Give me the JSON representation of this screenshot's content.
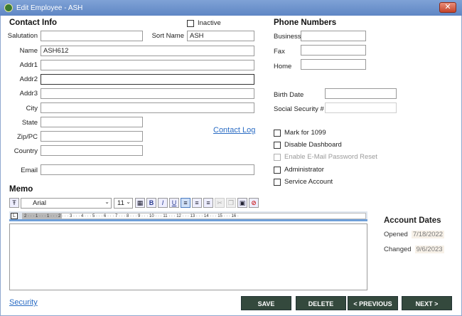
{
  "window": {
    "title": "Edit Employee - ASH",
    "close_glyph": "✕"
  },
  "contact": {
    "title": "Contact Info",
    "inactive_label": "Inactive",
    "salutation_label": "Salutation",
    "salutation_value": "",
    "sortname_label": "Sort Name",
    "sortname_value": "ASH",
    "name_label": "Name",
    "name_value": "ASH612",
    "addr1_label": "Addr1",
    "addr2_label": "Addr2",
    "addr3_label": "Addr3",
    "city_label": "City",
    "state_label": "State",
    "zip_label": "Zip/PC",
    "country_label": "Country",
    "email_label": "Email",
    "contact_log": "Contact Log"
  },
  "phone": {
    "title": "Phone Numbers",
    "business_label": "Business",
    "fax_label": "Fax",
    "home_label": "Home",
    "birth_label": "Birth Date",
    "ssn_label": "Social Security #"
  },
  "options": {
    "mark1099": "Mark for 1099",
    "disable_dashboard": "Disable Dashboard",
    "enable_email_reset": "Enable E-Mail Password Reset",
    "administrator": "Administrator",
    "service_account": "Service Account"
  },
  "memo": {
    "title": "Memo",
    "font": "Arial",
    "size": "11",
    "bold": "B",
    "italic": "I",
    "underline": "U",
    "ruler_text": "2 · · · 1 · · · 1 · · · 2 · · · 3 · · · 4 · · · 5 · · · 6 · · · 7 · · · 8 · · · 9 · · · 10 · · · 11 · · · 12 · · · 13 · · · 14 · · · 15 · · · 16 ·",
    "tab_marker": "L"
  },
  "account": {
    "title": "Account Dates",
    "opened_label": "Opened",
    "opened_value": "7/18/2022",
    "changed_label": "Changed",
    "changed_value": "9/6/2023"
  },
  "footer": {
    "security": "Security",
    "save": "SAVE",
    "delete": "DELETE",
    "previous": "< PREVIOUS",
    "next": "NEXT >"
  }
}
